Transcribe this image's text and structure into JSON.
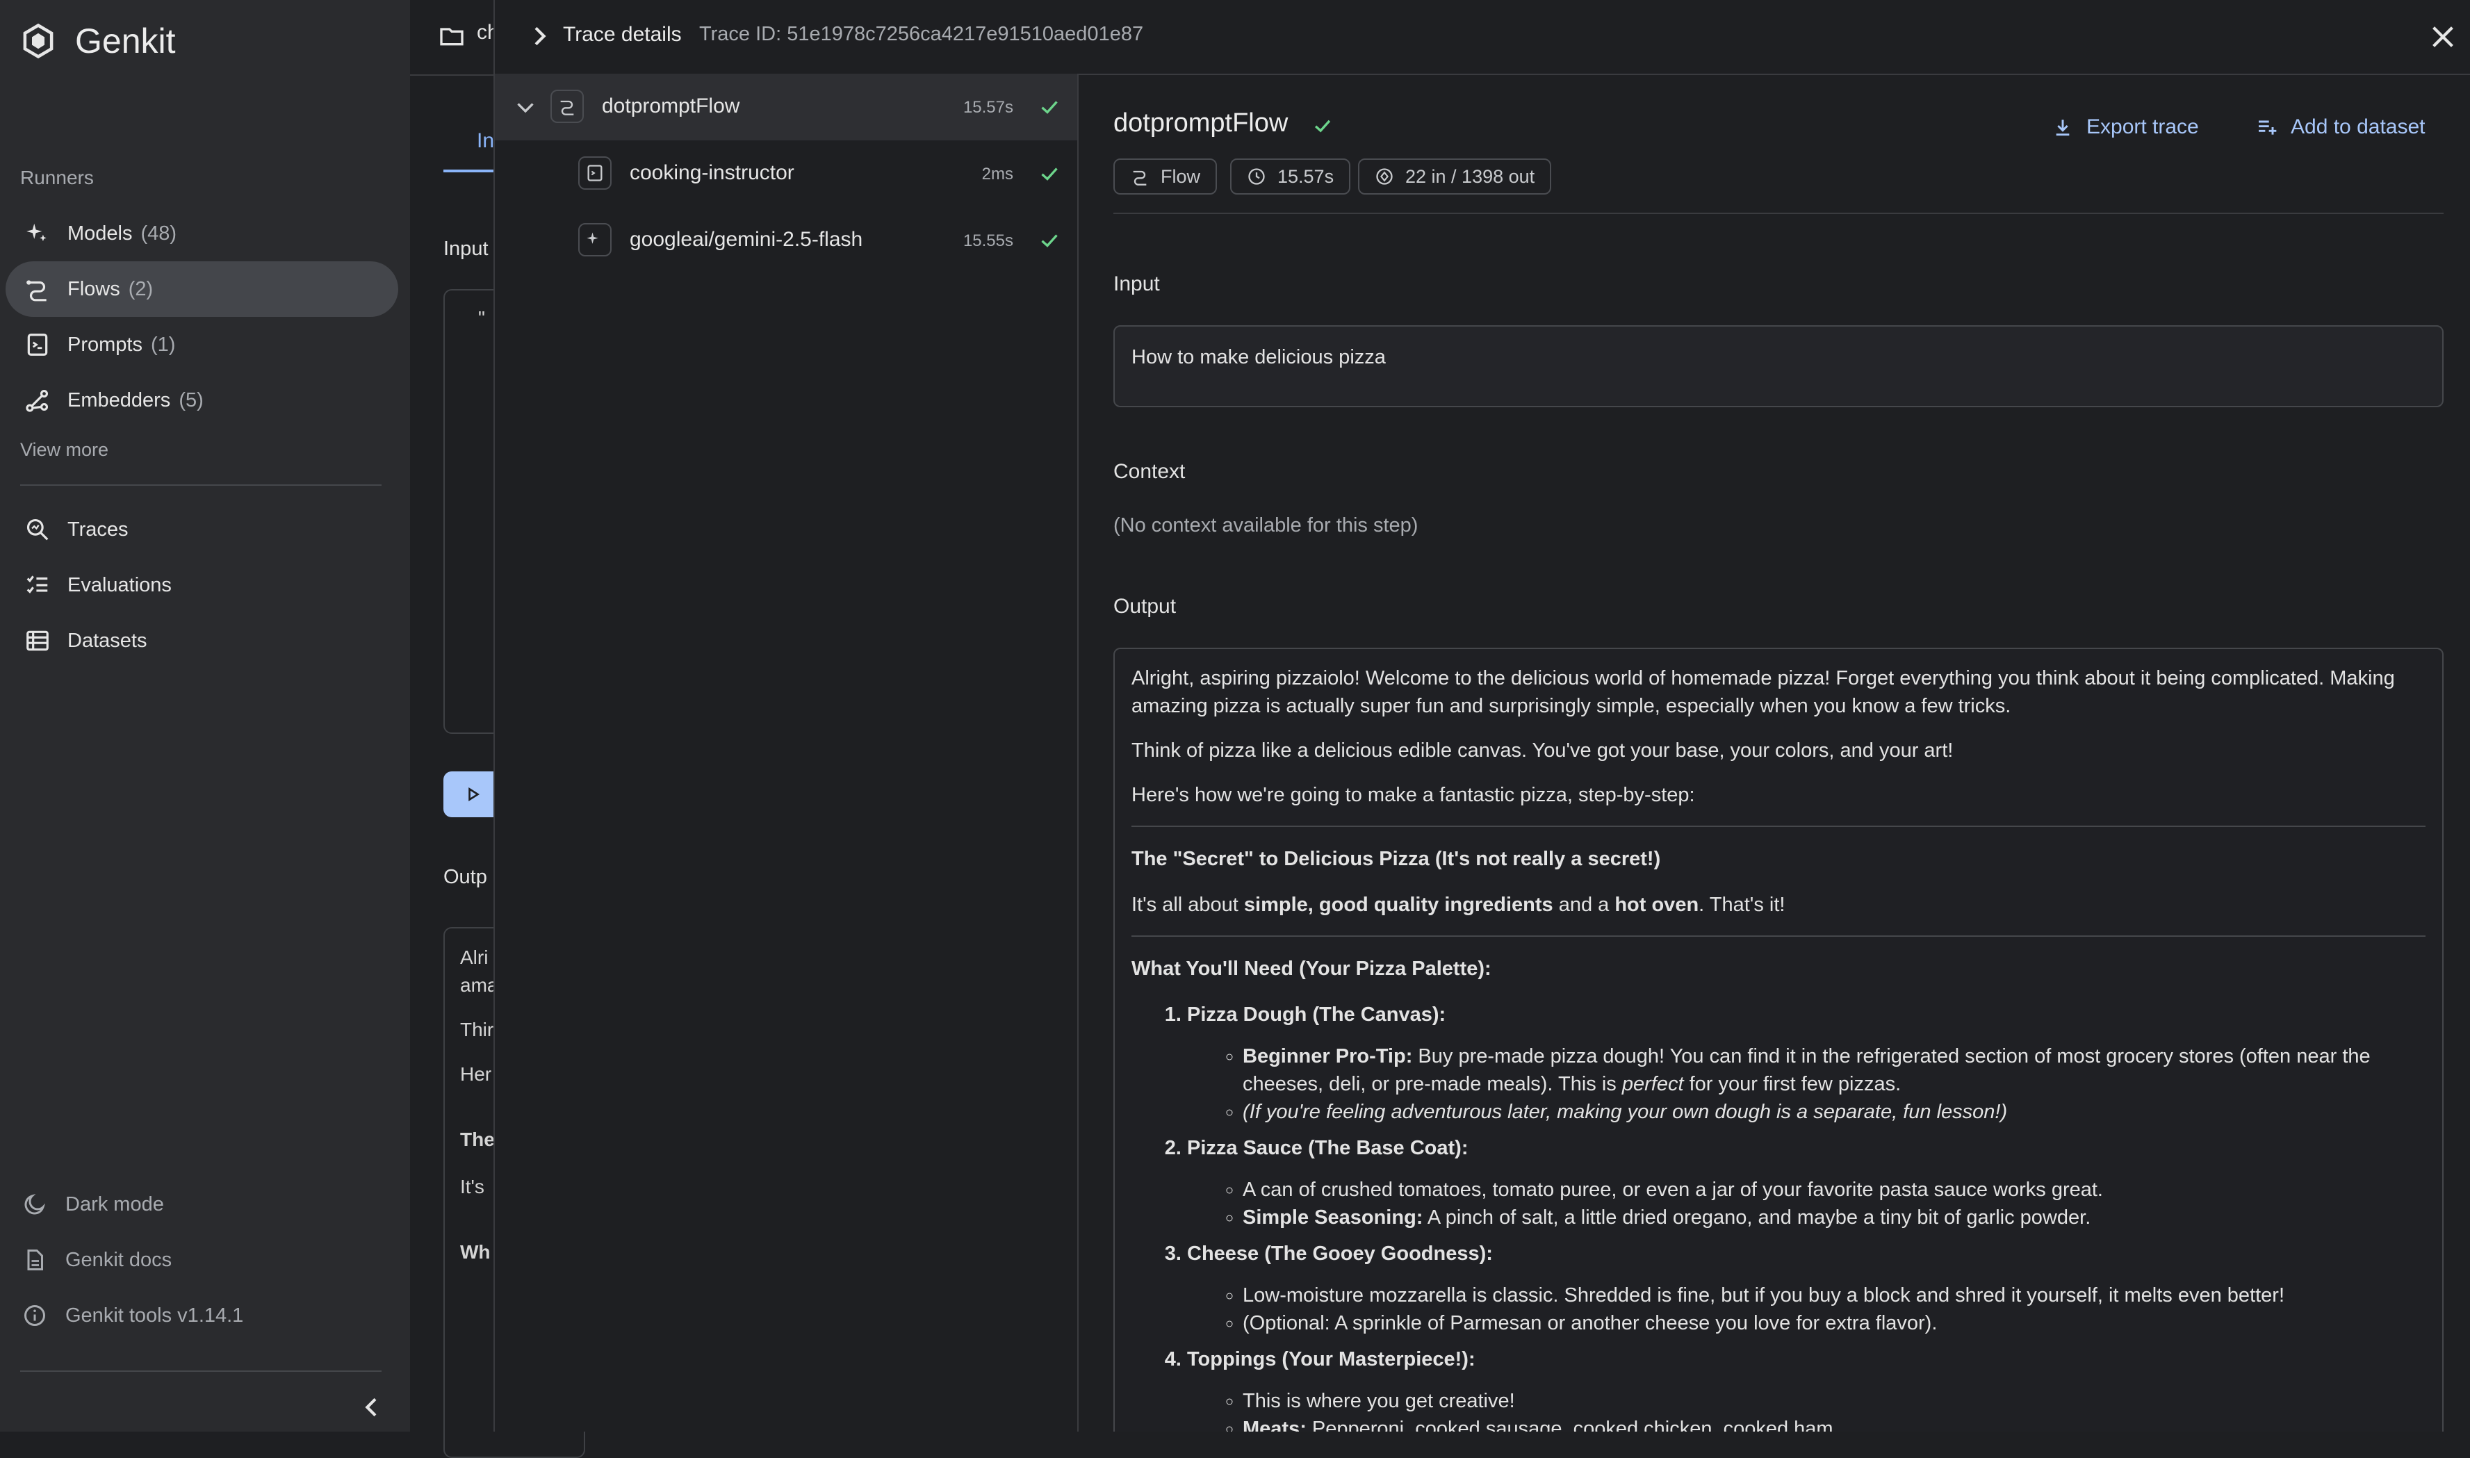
{
  "app": {
    "brand": "Genkit",
    "runners_label": "Runners",
    "nav": [
      {
        "label": "Models",
        "count": "(48)",
        "icon": "sparkle-icon"
      },
      {
        "label": "Flows",
        "count": "(2)",
        "icon": "flow-icon"
      },
      {
        "label": "Prompts",
        "count": "(1)",
        "icon": "prompt-icon"
      },
      {
        "label": "Embedders",
        "count": "(5)",
        "icon": "embedder-icon"
      }
    ],
    "view_more": "View more",
    "nav2": [
      {
        "label": "Traces",
        "icon": "traces-icon"
      },
      {
        "label": "Evaluations",
        "icon": "evaluations-icon"
      },
      {
        "label": "Datasets",
        "icon": "datasets-icon"
      }
    ],
    "bottom": [
      {
        "label": "Dark mode",
        "icon": "moon-icon"
      },
      {
        "label": "Genkit docs",
        "icon": "doc-icon"
      },
      {
        "label": "Genkit tools v1.14.1",
        "icon": "info-icon"
      }
    ]
  },
  "runner": {
    "crumb": "ch",
    "tab": "In",
    "input_label": "Input",
    "input_frag": "\"",
    "output_label": "Outp",
    "frags": [
      "Alri",
      "ama",
      "Thir",
      "Her",
      "The",
      "It's",
      "Wh"
    ]
  },
  "drawer": {
    "title": "Trace details",
    "trace_id": "Trace ID: 51e1978c7256ca4217e91510aed01e87",
    "spans": [
      {
        "name": "dotpromptFlow",
        "time": "15.57s"
      },
      {
        "name": "cooking-instructor",
        "time": "2ms"
      },
      {
        "name": "googleai/gemini-2.5-flash",
        "time": "15.55s"
      }
    ],
    "detail": {
      "title": "dotpromptFlow",
      "export": "Export trace",
      "add_dataset": "Add to dataset",
      "chips": [
        "Flow",
        "15.57s",
        "22 in / 1398 out"
      ],
      "input_label": "Input",
      "input_value": "How to make delicious pizza",
      "context_label": "Context",
      "context_value": "(No context available for this step)",
      "output_label": "Output",
      "output": {
        "p1": "Alright, aspiring pizzaiolo! Welcome to the delicious world of homemade pizza! Forget everything you think about it being complicated. Making amazing pizza is actually super fun and surprisingly simple, especially when you know a few tricks.",
        "p2": "Think of pizza like a delicious edible canvas. You've got your base, your colors, and your art!",
        "p3": "Here's how we're going to make a fantastic pizza, step-by-step:",
        "h1": "The \"Secret\" to Delicious Pizza (It's not really a secret!)",
        "p4_a": "It's all about ",
        "p4_b": "simple, good quality ingredients",
        "p4_c": " and a ",
        "p4_d": "hot oven",
        "p4_e": ". That's it!",
        "h2": "What You'll Need (Your Pizza Palette):",
        "item1": "Pizza Dough (The Canvas):",
        "item1_b1_bold": "Beginner Pro-Tip:",
        "item1_b1_text": " Buy pre-made pizza dough! You can find it in the refrigerated section of most grocery stores (often near the cheeses, deli, or pre-made meals). This is ",
        "item1_b1_it": "perfect",
        "item1_b1_end": " for your first few pizzas.",
        "item1_b2": "(If you're feeling adventurous later, making your own dough is a separate, fun lesson!)",
        "item2": "Pizza Sauce (The Base Coat):",
        "item2_b1": "A can of crushed tomatoes, tomato puree, or even a jar of your favorite pasta sauce works great.",
        "item2_b2_bold": "Simple Seasoning:",
        "item2_b2_text": " A pinch of salt, a little dried oregano, and maybe a tiny bit of garlic powder.",
        "item3": "Cheese (The Gooey Goodness):",
        "item3_b1": "Low-moisture mozzarella is classic. Shredded is fine, but if you buy a block and shred it yourself, it melts even better!",
        "item3_b2": "(Optional: A sprinkle of Parmesan or another cheese you love for extra flavor).",
        "item4": "Toppings (Your Masterpiece!):",
        "item4_b1": "This is where you get creative!",
        "item4_b2_bold": "Meats:",
        "item4_b2_text": " Pepperoni, cooked sausage, cooked chicken, cooked ham."
      }
    }
  },
  "colors": {
    "accent": "#a8c7fa",
    "success": "#6dd58c",
    "sidebar_bg": "#2a2b2e",
    "page_bg": "#1e1f22"
  }
}
